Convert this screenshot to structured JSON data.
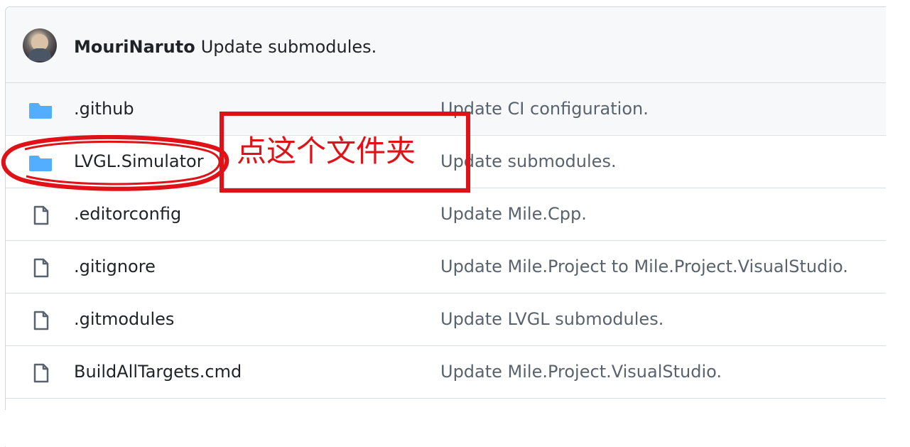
{
  "latest_commit": {
    "author": "MouriNaruto",
    "message": "Update submodules.",
    "avatar_icon": "avatar"
  },
  "files": [
    {
      "name": ".github",
      "commit_message": "Update CI configuration.",
      "icon": "folder-icon"
    },
    {
      "name": "LVGL.Simulator",
      "commit_message": "Update submodules.",
      "icon": "folder-icon"
    },
    {
      "name": ".editorconfig",
      "commit_message": "Update Mile.Cpp.",
      "icon": "file-icon"
    },
    {
      "name": ".gitignore",
      "commit_message": "Update Mile.Project to Mile.Project.VisualStudio.",
      "icon": "file-icon"
    },
    {
      "name": ".gitmodules",
      "commit_message": "Update LVGL submodules.",
      "icon": "file-icon"
    },
    {
      "name": "BuildAllTargets.cmd",
      "commit_message": "Update Mile.Project.VisualStudio.",
      "icon": "file-icon"
    }
  ],
  "annotation": {
    "text": "点这个文件夹",
    "color": "#e01217"
  },
  "colors": {
    "folder": "#54aeff",
    "file": "#59636e",
    "muted_text": "#59636e",
    "border": "#d8dee4",
    "header_bg": "#f6f8fa"
  }
}
